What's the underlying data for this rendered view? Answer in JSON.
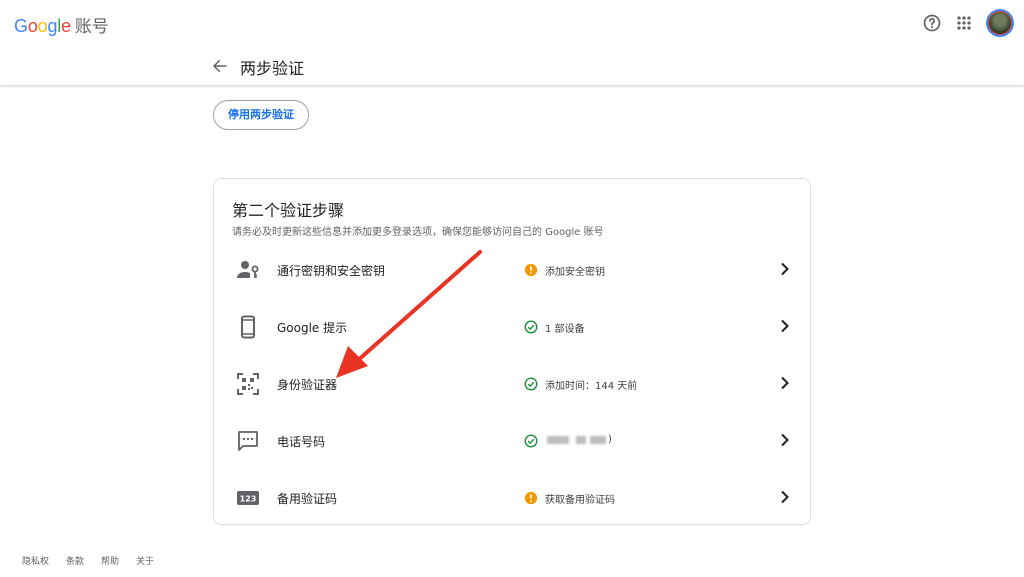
{
  "header": {
    "logo_letters": [
      "G",
      "o",
      "o",
      "g",
      "l",
      "e"
    ],
    "product": "账号",
    "icons": [
      "help-icon",
      "apps-icon",
      "avatar"
    ]
  },
  "subheader": {
    "back_icon": "arrow-left-icon",
    "title": "两步验证"
  },
  "disable_button": "停用两步验证",
  "card": {
    "title": "第二个验证步骤",
    "subtitle": "请务必及时更新这些信息并添加更多登录选项，确保您能够访问自己的 Google 账号",
    "rows": [
      {
        "icon": "passkey-person-icon",
        "label": "通行密钥和安全密钥",
        "status_icon": "warning-icon",
        "status": "添加安全密钥"
      },
      {
        "icon": "phone-icon",
        "label": "Google 提示",
        "status_icon": "check-icon",
        "status": "1 部设备"
      },
      {
        "icon": "qr-scan-icon",
        "label": "身份验证器",
        "status_icon": "check-icon",
        "status": "添加时间：144 天前"
      },
      {
        "icon": "message-icon",
        "label": "电话号码",
        "status_icon": "check-icon",
        "status": ")"
      },
      {
        "icon": "backup-codes-icon",
        "label": "备用验证码",
        "status_icon": "warning-icon",
        "status": "获取备用验证码"
      }
    ]
  },
  "footer": [
    "隐私权",
    "条款",
    "帮助",
    "关于"
  ],
  "colors": {
    "google_blue": "#4285f4",
    "google_red": "#ea4335",
    "google_yellow": "#fbbc05",
    "google_green": "#34a853",
    "link_blue": "#1a73e8",
    "warning": "#f29900",
    "success": "#1e8e3e",
    "annotation_arrow": "#ea3323"
  }
}
